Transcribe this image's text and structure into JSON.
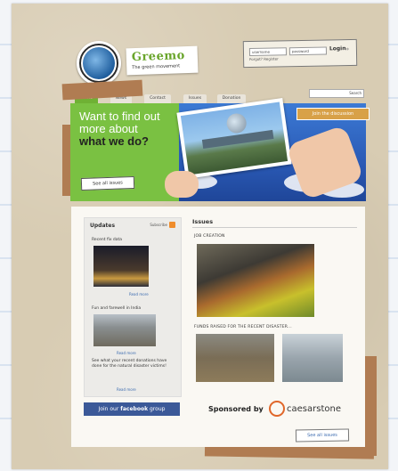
{
  "brand": {
    "name": "Greemo",
    "tagline": "The green movement"
  },
  "login": {
    "username_placeholder": "username",
    "password_placeholder": "password",
    "button": "Login",
    "forgot": "Forgot? Register"
  },
  "nav": {
    "tabs": [
      "Home",
      "News",
      "Contact",
      "Issues",
      "Donation"
    ],
    "active": 0
  },
  "search": {
    "placeholder": "Search"
  },
  "banner": {
    "headline_line1": "Want to find out",
    "headline_line2": "more about",
    "headline_bold": "what we do?",
    "see_all": "See all issues",
    "join_discussion": "Join the discussion"
  },
  "updates": {
    "title": "Updates",
    "rss_label": "Subscribe",
    "items": [
      {
        "title": "Recent fix data",
        "more": "Read more"
      },
      {
        "title": "Fun and farewell in India",
        "more": "Read more"
      },
      {
        "title": "See what your recent donations have done for the natural disaster victims!",
        "more": "Read more"
      }
    ]
  },
  "facebook": {
    "prefix": "Join our",
    "brand": "facebook",
    "suffix": "group"
  },
  "issues": {
    "title": "Issues",
    "items": [
      {
        "label": "JOB CREATION"
      },
      {
        "label": "FUNDS RAISED FOR THE RECENT DISASTER..."
      }
    ],
    "see_all": "See all issues"
  },
  "sponsor": {
    "label": "Sponsored by",
    "company": "caesarstone"
  },
  "colors": {
    "green": "#7ac142",
    "blue": "#2d57b8",
    "facebook": "#3b5998",
    "paper": "#d8ccb3"
  }
}
